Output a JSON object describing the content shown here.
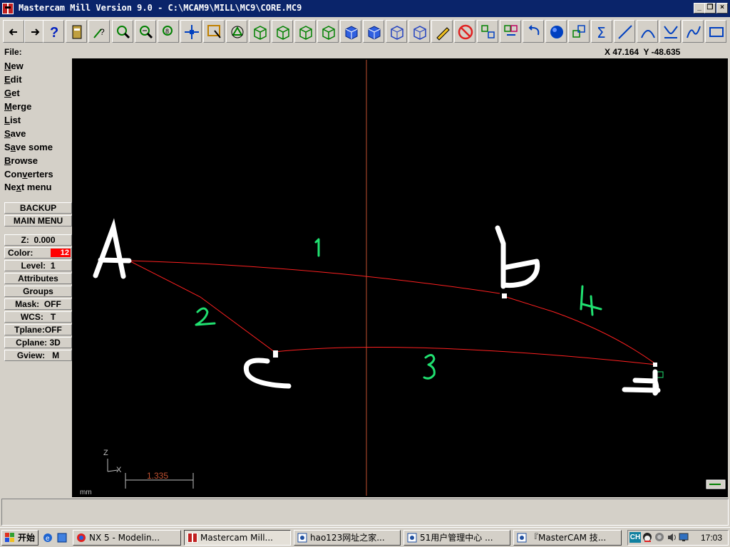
{
  "window": {
    "title": "Mastercam Mill Version 9.0 - C:\\MCAM9\\MILL\\MC9\\CORE.MC9",
    "minimize": "_",
    "restore": "❐",
    "close": "×"
  },
  "statusbar": {
    "menu_title": "File:",
    "coords": "X 47.164  Y -48.635"
  },
  "menu": {
    "items": [
      {
        "key": "N",
        "rest": "ew"
      },
      {
        "key": "E",
        "rest": "dit"
      },
      {
        "key": "G",
        "rest": "et"
      },
      {
        "key": "M",
        "rest": "erge"
      },
      {
        "key": "L",
        "rest": "ist"
      },
      {
        "key": "S",
        "rest": "ave"
      },
      {
        "pre": "S",
        "key": "a",
        "rest": "ve some"
      },
      {
        "key": "B",
        "rest": "rowse"
      },
      {
        "pre": "Con",
        "key": "v",
        "rest": "erters"
      },
      {
        "pre": "Ne",
        "key": "x",
        "rest": "t menu"
      }
    ],
    "backup": "BACKUP",
    "main_menu": "MAIN MENU"
  },
  "params": {
    "z": "Z:  0.000",
    "color_label": "Color:",
    "color_value": "12",
    "level": "Level:  1",
    "attributes": "Attributes",
    "groups": "Groups",
    "mask": "Mask:  OFF",
    "wcs": "WCS:   T",
    "tplane": "Tplane:OFF",
    "cplane": "Cplane: 3D",
    "gview": "Gview:   M"
  },
  "canvas": {
    "axis_z": "Z",
    "axis_x": "X",
    "units": "mm",
    "scale_value": "1.335",
    "labels": {
      "a": "A",
      "b": "b",
      "c": "c",
      "d": "d",
      "one": "1",
      "two": "2",
      "three": "3",
      "four": "4"
    }
  },
  "taskbar": {
    "start": "开始",
    "tasks": [
      "NX 5 - Modelin...",
      "Mastercam Mill...",
      "hao123网址之家...",
      "51用户管理中心 ...",
      "『MasterCAM 技..."
    ],
    "ime": "CH",
    "clock": "17:03"
  },
  "colors": {
    "titlebar": "#0a246a",
    "canvas": "#000000",
    "curve": "#ff2020",
    "axis": "#c05030",
    "annotation_green": "#20e070"
  },
  "icons": [
    "back-arrow-icon",
    "forward-arrow-icon",
    "help-icon",
    "file-icon",
    "analyze-icon",
    "zoom-icon",
    "unzoom-icon",
    "zoom-window-icon",
    "pan-icon",
    "select-icon",
    "rotate-icon",
    "view-top-icon",
    "view-front-icon",
    "view-side-icon",
    "view-iso-icon",
    "cube-blue-icon",
    "cube-blue-2-icon",
    "cube-blue-3-icon",
    "cube-blue-4-icon",
    "pencil-icon",
    "no-icon",
    "transform-icon",
    "transform-2-icon",
    "undo-icon",
    "sphere-icon",
    "group-icon",
    "sum-icon",
    "line-icon",
    "arc-icon",
    "fillet-icon",
    "spline-icon",
    "rectangle-icon"
  ]
}
